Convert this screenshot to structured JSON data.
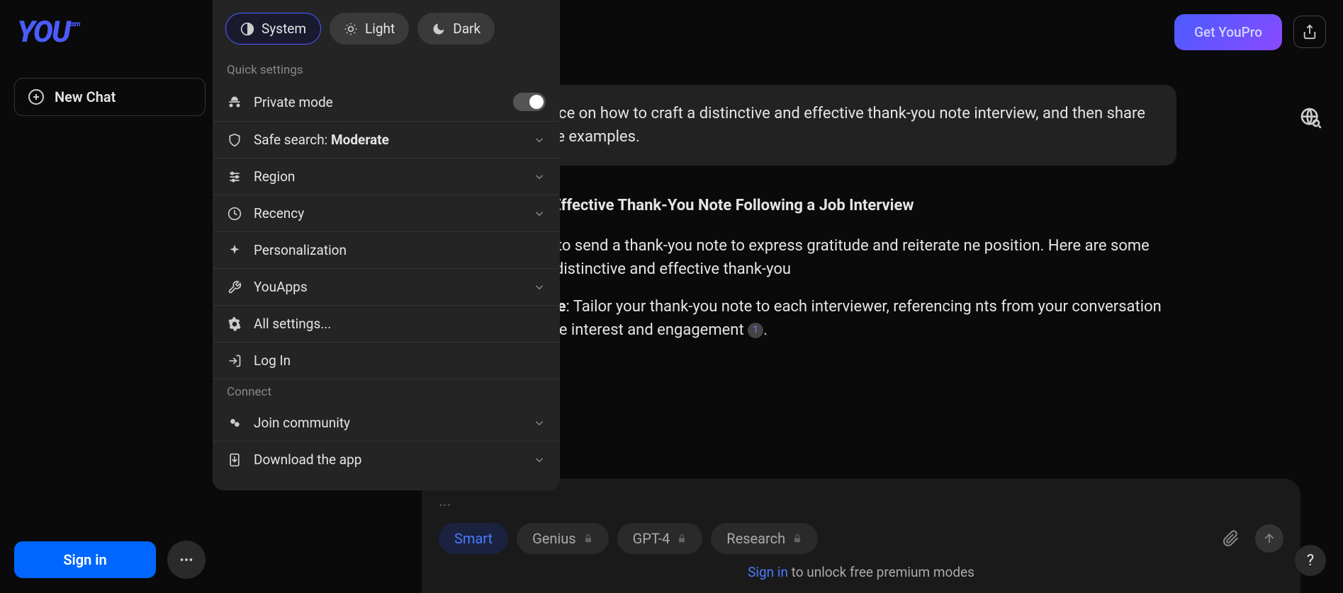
{
  "header": {
    "logo_text": "YOU",
    "logo_suffix": ".com",
    "get_pro": "Get YouPro"
  },
  "sidebar": {
    "new_chat": "New Chat",
    "sign_in": "Sign in"
  },
  "settings": {
    "themes": {
      "system": "System",
      "light": "Light",
      "dark": "Dark"
    },
    "quick_label": "Quick settings",
    "private_mode": "Private mode",
    "safe_search_prefix": "Safe search: ",
    "safe_search_value": "Moderate",
    "region": "Region",
    "recency": "Recency",
    "personalization": "Personalization",
    "youapps": "YouApps",
    "all_settings": "All settings...",
    "log_in": "Log In",
    "connect_label": "Connect",
    "join_community": "Join community",
    "download_app": "Download the app"
  },
  "conversation": {
    "user_message": "tips and guidance on how to craft a distinctive and effective thank-you note interview, and then share a few illustrative examples.",
    "heading": "a Distinctive and Effective Thank-You Note Following a Job Interview",
    "paragraph": "iew, it's important to send a thank-you note to express gratitude and reiterate ne position. Here are some tips for crafting a distinctive and effective thank-you",
    "tip1_bold": "e Your Message",
    "tip1_rest": ": Tailor your thank-you note to each interviewer, referencing nts from your conversation to show genuine interest and engagement ",
    "tip1_cite": "1",
    "tip1_period": "."
  },
  "input": {
    "placeholder": "...",
    "modes": {
      "smart": "Smart",
      "genius": "Genius",
      "gpt4": "GPT-4",
      "research": "Research"
    },
    "unlock_link": "Sign in",
    "unlock_rest": " to unlock free premium modes"
  },
  "help": "?"
}
